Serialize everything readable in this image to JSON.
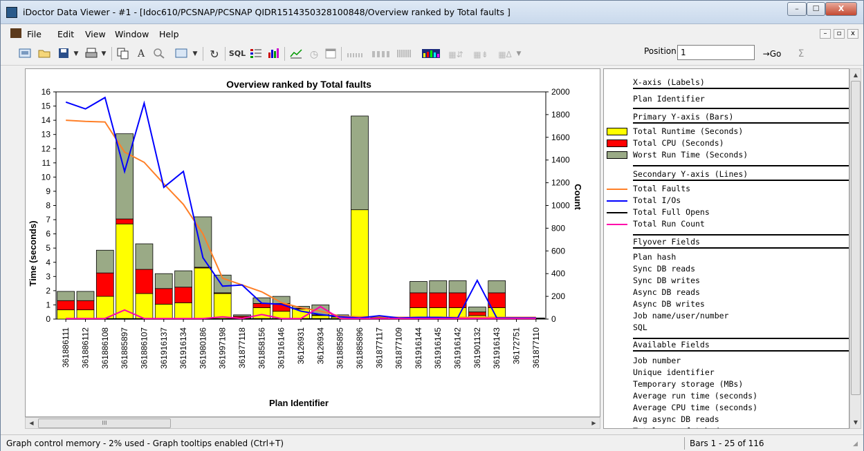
{
  "window": {
    "title": "iDoctor Data Viewer - #1 - [Idoc610/PCSNAP/PCSNAP   QIDR1514350328100848/Overview ranked by Total faults ]",
    "min_label": "–",
    "max_label": "☐",
    "close_label": "X"
  },
  "menu": {
    "items": [
      "File",
      "Edit",
      "View",
      "Window",
      "Help"
    ],
    "mdi": [
      "–",
      "▫",
      "x"
    ]
  },
  "toolbar": {
    "sql_label": "SQL",
    "font_label": "A",
    "position_label": "Position",
    "position_value": "1",
    "go_label": "→Go",
    "sigma_label": "Σ"
  },
  "chart_data": {
    "type": "bar",
    "title": "Overview ranked by Total faults",
    "xlabel": "Plan Identifier",
    "ylabel": "Time (seconds)",
    "y2label": "Count",
    "ylim": [
      0,
      16
    ],
    "y2lim": [
      0,
      2000
    ],
    "yticks": [
      0,
      1,
      2,
      3,
      4,
      5,
      6,
      7,
      8,
      9,
      10,
      11,
      12,
      13,
      14,
      15,
      16
    ],
    "y2ticks": [
      0,
      200,
      400,
      600,
      800,
      1000,
      1200,
      1400,
      1600,
      1800,
      2000
    ],
    "categories": [
      "361886111",
      "361886112",
      "361886108",
      "361885897",
      "361886107",
      "361916137",
      "361916134",
      "361980186",
      "361997198",
      "361877118",
      "361858156",
      "361916146",
      "36126931",
      "36126934",
      "361885895",
      "361885896",
      "361877117",
      "361877109",
      "361916144",
      "361916145",
      "361916142",
      "361901132",
      "361916143",
      "36172751",
      "361877110"
    ],
    "bar_series": [
      {
        "name": "Total Runtime (Seconds)",
        "color": "#ffff00",
        "values": [
          0.65,
          0.65,
          1.6,
          6.7,
          1.8,
          1.05,
          1.15,
          3.6,
          1.8,
          0.1,
          0.8,
          0.55,
          0.7,
          0.25,
          0.15,
          7.7,
          0.05,
          0.05,
          0.8,
          0.8,
          0.8,
          0.25,
          0.8,
          0.03,
          0.03
        ]
      },
      {
        "name": "Total CPU (Seconds)",
        "color": "#ff0000",
        "values": [
          0.65,
          0.65,
          1.65,
          0.35,
          1.7,
          1.1,
          1.1,
          0.05,
          0.05,
          0.1,
          0.3,
          0.55,
          0.05,
          0.05,
          0.05,
          0.0,
          0.02,
          0.05,
          1.05,
          1.05,
          1.05,
          0.25,
          1.05,
          0.02,
          0.02
        ]
      },
      {
        "name": "Worst Run Time (Seconds)",
        "color": "#9aaa86",
        "values": [
          0.65,
          0.65,
          1.6,
          6.0,
          1.8,
          1.05,
          1.15,
          3.55,
          1.25,
          0.1,
          0.4,
          0.5,
          0.15,
          0.7,
          0.1,
          6.6,
          0.05,
          0.05,
          0.8,
          0.85,
          0.85,
          0.35,
          0.85,
          0.03,
          0.03
        ]
      }
    ],
    "line_series": [
      {
        "name": "Total Faults",
        "color": "#ff7f27",
        "values": [
          1750,
          1740,
          1735,
          1470,
          1380,
          1190,
          1010,
          750,
          360,
          300,
          240,
          145,
          100,
          70,
          25,
          20,
          20,
          15,
          15,
          15,
          15,
          15,
          15,
          15,
          15
        ]
      },
      {
        "name": "Total I/Os",
        "color": "#0000ff",
        "values": [
          1910,
          1850,
          1950,
          1300,
          1900,
          1160,
          1300,
          540,
          290,
          300,
          140,
          130,
          70,
          40,
          20,
          10,
          30,
          10,
          15,
          15,
          10,
          340,
          10,
          10,
          10
        ]
      },
      {
        "name": "Total Full Opens",
        "color": "#000000",
        "values": [
          2,
          2,
          2,
          2,
          2,
          2,
          2,
          2,
          2,
          2,
          2,
          2,
          2,
          2,
          2,
          2,
          2,
          2,
          2,
          2,
          2,
          2,
          2,
          2,
          2
        ]
      },
      {
        "name": "Total Run Count",
        "color": "#ff00aa",
        "values": [
          5,
          5,
          5,
          80,
          5,
          5,
          5,
          5,
          20,
          5,
          40,
          5,
          5,
          110,
          5,
          5,
          5,
          5,
          5,
          5,
          5,
          5,
          5,
          5,
          5
        ]
      }
    ],
    "grid": false
  },
  "legend": {
    "xaxis_header": "X-axis (Labels)",
    "xaxis_item": "Plan Identifier",
    "primary_header": "Primary Y-axis (Bars)",
    "primary_items": [
      {
        "label": "Total Runtime (Seconds)",
        "color": "#ffff00"
      },
      {
        "label": "Total CPU (Seconds)",
        "color": "#ff0000"
      },
      {
        "label": "Worst Run Time (Seconds)",
        "color": "#9aaa86"
      }
    ],
    "secondary_header": "Secondary Y-axis (Lines)",
    "secondary_items": [
      {
        "label": "Total Faults",
        "color": "#ff7f27"
      },
      {
        "label": "Total I/Os",
        "color": "#0000ff"
      },
      {
        "label": "Total Full Opens",
        "color": "#000000"
      },
      {
        "label": "Total Run Count",
        "color": "#ff00aa"
      }
    ],
    "flyover_header": "Flyover Fields",
    "flyover_items": [
      "Plan hash",
      "Sync DB reads",
      "Sync DB writes",
      "Async DB reads",
      "Async DB writes",
      "Job name/user/number",
      "SQL"
    ],
    "available_header": "Available Fields",
    "available_items": [
      "Job number",
      "Unique identifier",
      "Temporary storage (MBs)",
      "Average run time (seconds)",
      "Average CPU time (seconds)",
      "Avg async DB reads",
      "Total rows fetched"
    ]
  },
  "status": {
    "left": "Graph control memory - 2% used - Graph tooltips enabled (Ctrl+T)",
    "right": "Bars 1 - 25 of 116"
  },
  "scrollbar": {
    "thumb_grip": "III"
  }
}
